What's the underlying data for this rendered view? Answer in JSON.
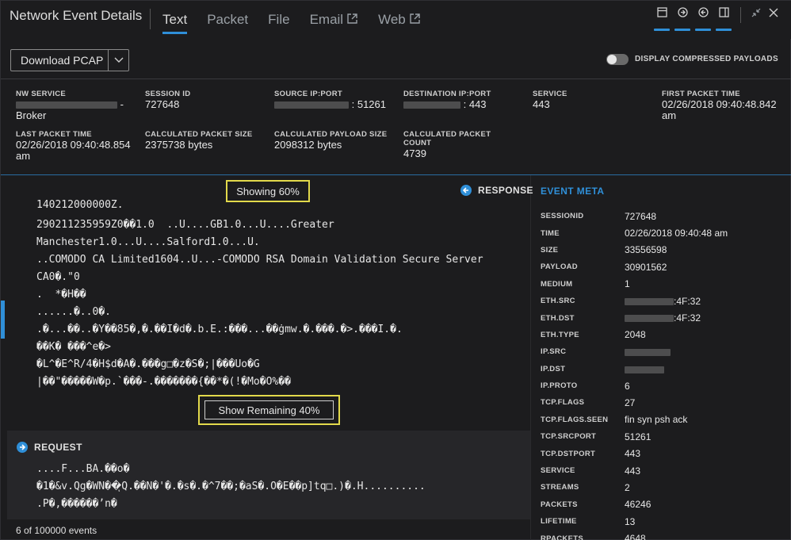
{
  "header": {
    "title": "Network Event Details",
    "tabs": [
      {
        "label": "Text"
      },
      {
        "label": "Packet"
      },
      {
        "label": "File"
      },
      {
        "label": "Email"
      },
      {
        "label": "Web"
      }
    ]
  },
  "toolbar": {
    "download_label": "Download PCAP",
    "toggle_label": "DISPLAY COMPRESSED PAYLOADS",
    "toggle_on": false
  },
  "summary": {
    "nw_service": {
      "label": "NW SERVICE",
      "value": "- Broker"
    },
    "session_id": {
      "label": "SESSION ID",
      "value": "727648"
    },
    "source": {
      "label": "SOURCE IP:PORT",
      "value": ": 51261"
    },
    "destination": {
      "label": "DESTINATION IP:PORT",
      "value": ": 443"
    },
    "service": {
      "label": "SERVICE",
      "value": "443"
    },
    "first_packet": {
      "label": "FIRST PACKET TIME",
      "value": "02/26/2018 09:40:48.842 am"
    },
    "last_packet": {
      "label": "LAST PACKET TIME",
      "value": "02/26/2018 09:40:48.854 am"
    },
    "packet_size": {
      "label": "CALCULATED PACKET SIZE",
      "value": "2375738 bytes"
    },
    "payload_size": {
      "label": "CALCULATED PAYLOAD SIZE",
      "value": "2098312 bytes"
    },
    "packet_count": {
      "label": "CALCULATED PACKET COUNT",
      "value": "4739"
    }
  },
  "response": {
    "showing": "Showing 60%",
    "header": "RESPONSE",
    "first_line": "140212000000Z.",
    "lines": [
      "290211235959Z0��1.0  ..U....GB1.0...U....Greater",
      "Manchester1.0...U....Salford1.0...U.",
      "..COMODO CA Limited1604..U...-COMODO RSA Domain Validation Secure Server",
      "CA0�.\"0",
      ".  *�H��",
      "......�..0�.",
      ".�...��..�Y��85�,�.��I�d�.b.E.:���...��ġmw.�.���.�>.���I.�.",
      "��K� ���^e�>",
      "�L^�E^R/4�H$d�A�.���g□�z�S�;|���Uo�G",
      "|��\"�����W�p.`���-.�������{��*�(!�Mo�O%��"
    ],
    "show_remaining": "Show Remaining 40%"
  },
  "request": {
    "header": "REQUEST",
    "lines": [
      "....F...BA.��o�",
      "�1�&v.Qg�WN��ͅQ.��N�'�.�s�.�^7��;�aS�.O�E��p]tq□.)�.H..........",
      ".P�,������ʼn�"
    ]
  },
  "footer": {
    "events": "6 of 100000 events"
  },
  "meta": {
    "title": "EVENT META",
    "rows": [
      {
        "k": "SESSIONID",
        "v": "727648"
      },
      {
        "k": "TIME",
        "v": "02/26/2018 09:40:48 am"
      },
      {
        "k": "SIZE",
        "v": "33556598"
      },
      {
        "k": "PAYLOAD",
        "v": "30901562"
      },
      {
        "k": "MEDIUM",
        "v": "1"
      },
      {
        "k": "ETH.SRC",
        "v": ":4F:32"
      },
      {
        "k": "ETH.DST",
        "v": ":4F:32"
      },
      {
        "k": "ETH.TYPE",
        "v": "2048"
      },
      {
        "k": "IP.SRC",
        "v": ""
      },
      {
        "k": "IP.DST",
        "v": ""
      },
      {
        "k": "IP.PROTO",
        "v": "6"
      },
      {
        "k": "TCP.FLAGS",
        "v": "27"
      },
      {
        "k": "TCP.FLAGS.SEEN",
        "v": "fin syn psh ack"
      },
      {
        "k": "TCP.SRCPORT",
        "v": "51261"
      },
      {
        "k": "TCP.DSTPORT",
        "v": "443"
      },
      {
        "k": "SERVICE",
        "v": "443"
      },
      {
        "k": "STREAMS",
        "v": "2"
      },
      {
        "k": "PACKETS",
        "v": "46246"
      },
      {
        "k": "LIFETIME",
        "v": "13"
      },
      {
        "k": "RPACKETS",
        "v": "4648"
      }
    ]
  },
  "colors": {
    "accent": "#2f8fd8",
    "highlight": "#e2d94b",
    "background": "#1c1c1e"
  }
}
